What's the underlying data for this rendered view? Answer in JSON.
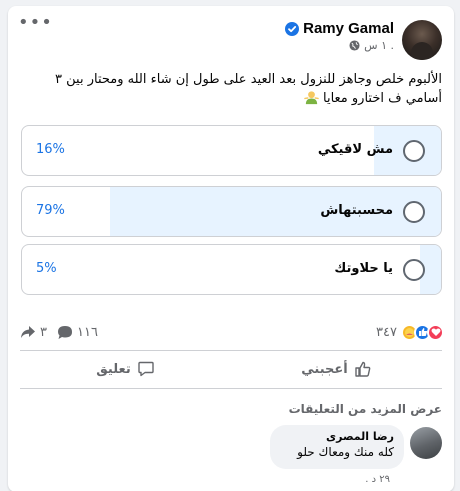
{
  "post": {
    "author_name": "Ramy Gamal",
    "timestamp": "١ س .",
    "text": "الألبوم خلص وجاهز للنزول بعد العيد على طول إن شاء الله ومحتار بين ٣ أسامي ف اختارو معايا",
    "verified_icon": "verified-badge-icon",
    "privacy_icon": "globe-icon",
    "more_icon": "more-dots-icon"
  },
  "poll": {
    "accent_color": "#1b74e4",
    "fill_color": "#e7f3ff",
    "options": [
      {
        "label": "مش لاقيكي",
        "percent_text": "16%",
        "percent": 16
      },
      {
        "label": "محسبتهاش",
        "percent_text": "79%",
        "percent": 79
      },
      {
        "label": "يا حلاوتك",
        "percent_text": "5%",
        "percent": 5
      }
    ]
  },
  "stats": {
    "reactions_count": "٣٤٧",
    "reaction_icons": [
      "care-icon",
      "like-icon",
      "love-icon"
    ],
    "comments_count": "١١٦",
    "shares_count": "٣"
  },
  "actions": {
    "like_label": "أعجبني",
    "comment_label": "تعليق"
  },
  "comments": {
    "view_more": "عرض المزيد من التعليقات",
    "first": {
      "author": "رضا المصرى",
      "text": "كله منك ومعاك حلو",
      "meta": "٢٩ د ."
    }
  }
}
